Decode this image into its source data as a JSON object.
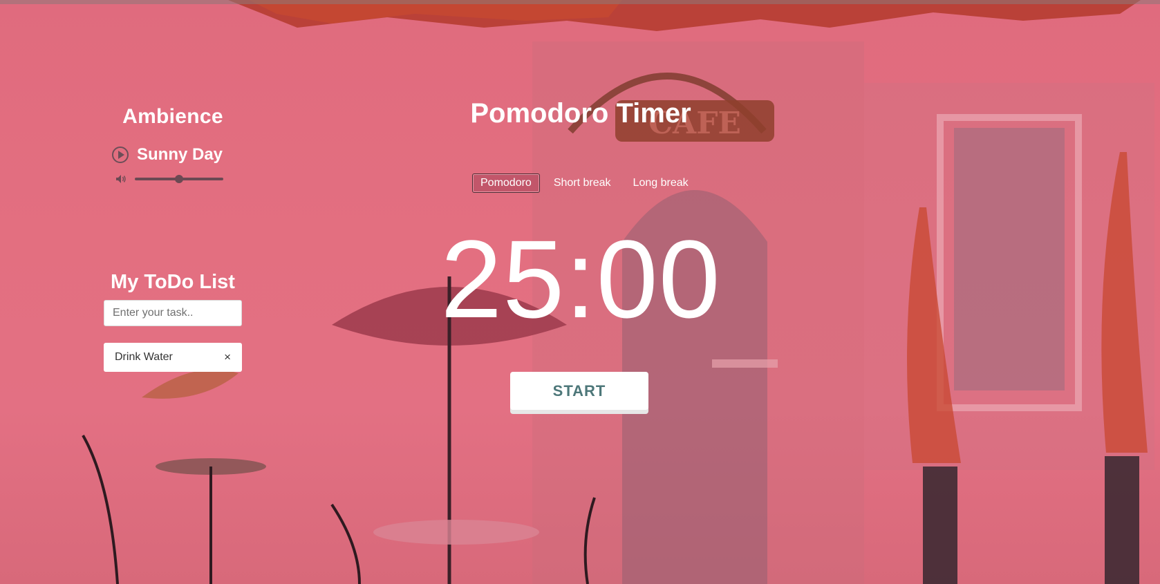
{
  "header": {
    "title": "Pomodoro Timer"
  },
  "ambience": {
    "title": "Ambience",
    "track_name": "Sunny Day",
    "volume_level": 0.5
  },
  "timer": {
    "modes": [
      "Pomodoro",
      "Short break",
      "Long break"
    ],
    "active_mode": "Pomodoro",
    "time": "25:00",
    "start_label": "START"
  },
  "todo": {
    "title": "My ToDo List",
    "input_placeholder": "Enter your task..",
    "tasks": [
      {
        "label": "Drink Water",
        "remove": "×"
      }
    ]
  },
  "colors": {
    "background_pink": "#e36f80",
    "text_white": "#ffffff",
    "button_text_teal": "#4d7779",
    "active_mode_bg": "#c2566a",
    "slider_dark": "#6b4953"
  },
  "icons": [
    "play-icon",
    "speaker-icon",
    "close-icon"
  ]
}
